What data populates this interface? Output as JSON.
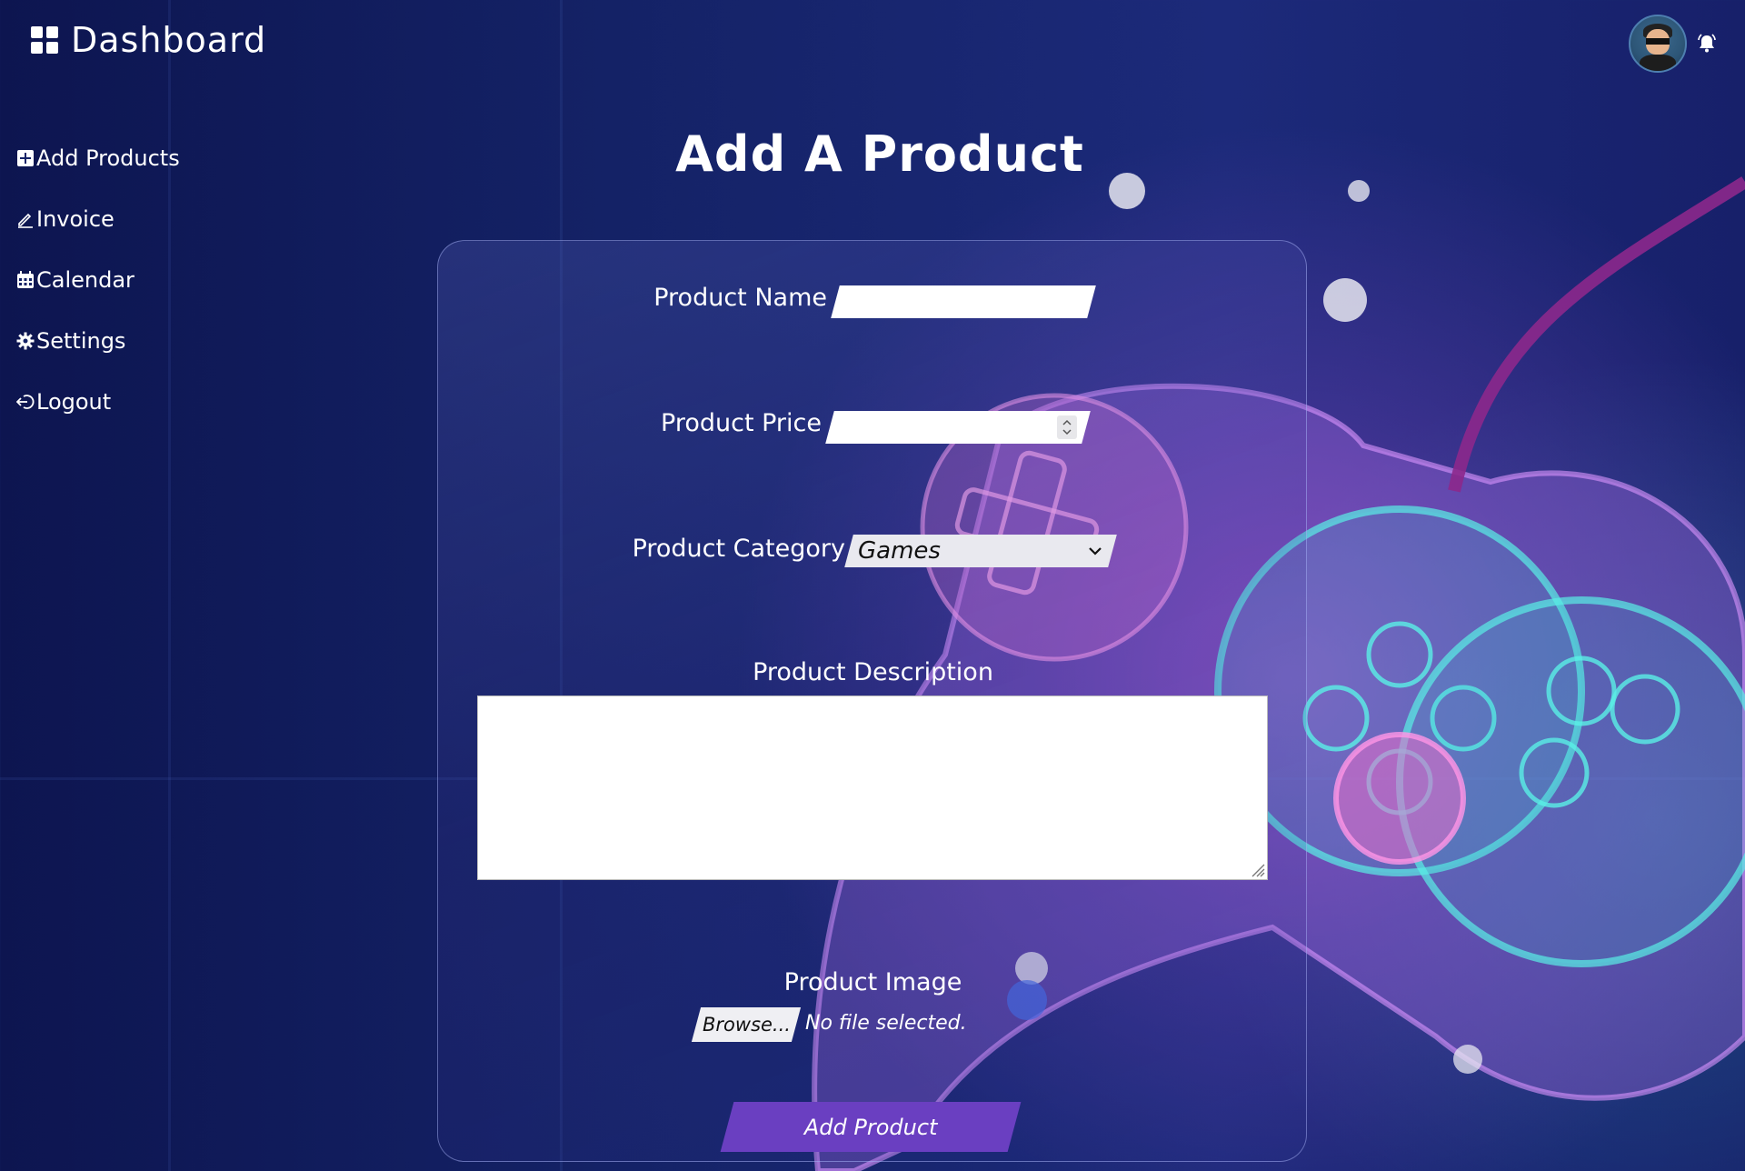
{
  "header": {
    "title": "Dashboard"
  },
  "sidebar": {
    "items": [
      {
        "label": "Add Products",
        "icon": "plus-square-icon"
      },
      {
        "label": "Invoice",
        "icon": "pen-icon"
      },
      {
        "label": "Calendar",
        "icon": "calendar-icon"
      },
      {
        "label": "Settings",
        "icon": "gear-icon"
      },
      {
        "label": "Logout",
        "icon": "logout-icon"
      }
    ]
  },
  "main": {
    "title": "Add A Product",
    "form": {
      "name_label": "Product Name",
      "name_value": "",
      "price_label": "Product Price",
      "price_value": "",
      "category_label": "Product Category",
      "category_value": "Games",
      "description_label": "Product Description",
      "description_value": "",
      "image_label": "Product Image",
      "browse_label": "Browse...",
      "no_file_text": "No file selected.",
      "submit_label": "Add Product"
    }
  },
  "colors": {
    "accent": "#6a3fc1",
    "background": "#142266"
  }
}
